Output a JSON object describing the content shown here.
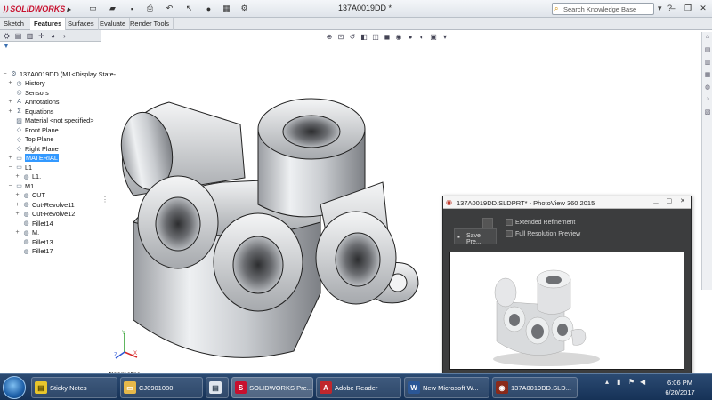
{
  "app": {
    "name": "SOLIDWORKS",
    "doc_title": "137A0019DD *"
  },
  "search": {
    "placeholder": "Search Knowledge Base"
  },
  "command_tabs": [
    "Sketch",
    "Features",
    "Surfaces",
    "Evaluate",
    "Render Tools"
  ],
  "tree": {
    "root": "137A0019DD  (M1<Display State-",
    "items": [
      "History",
      "Sensors",
      "Annotations",
      "Equations",
      "Material <not specified>",
      "Front Plane",
      "Top Plane",
      "Right Plane",
      "MATERIAL",
      "L1",
      "L1.",
      "M1",
      "CUT",
      "Cut-Revolve11",
      "Cut-Revolve12",
      "Fillet14",
      "M.",
      "Fillet13",
      "Fillet17"
    ]
  },
  "viewport": {
    "view_label": "*Isometric",
    "axis_labels": [
      "Y",
      "X",
      "Z"
    ]
  },
  "photoview": {
    "title": "137A0019DD.SLDPRT* - PhotoView 360 2015",
    "save_label": "Save Pre...",
    "options": [
      "Extended Refinement",
      "Full Resolution Preview"
    ]
  },
  "taskbar": {
    "items": [
      "Sticky Notes",
      "CJ0901080",
      "SOLIDWORKS Pre...",
      "Adobe Reader",
      "New Microsoft W...",
      "137A0019DD.SLD..."
    ],
    "time": "6:06 PM",
    "date": "6/20/2017"
  },
  "colors": {
    "accent": "#3399ff",
    "brand": "#c8102e"
  }
}
